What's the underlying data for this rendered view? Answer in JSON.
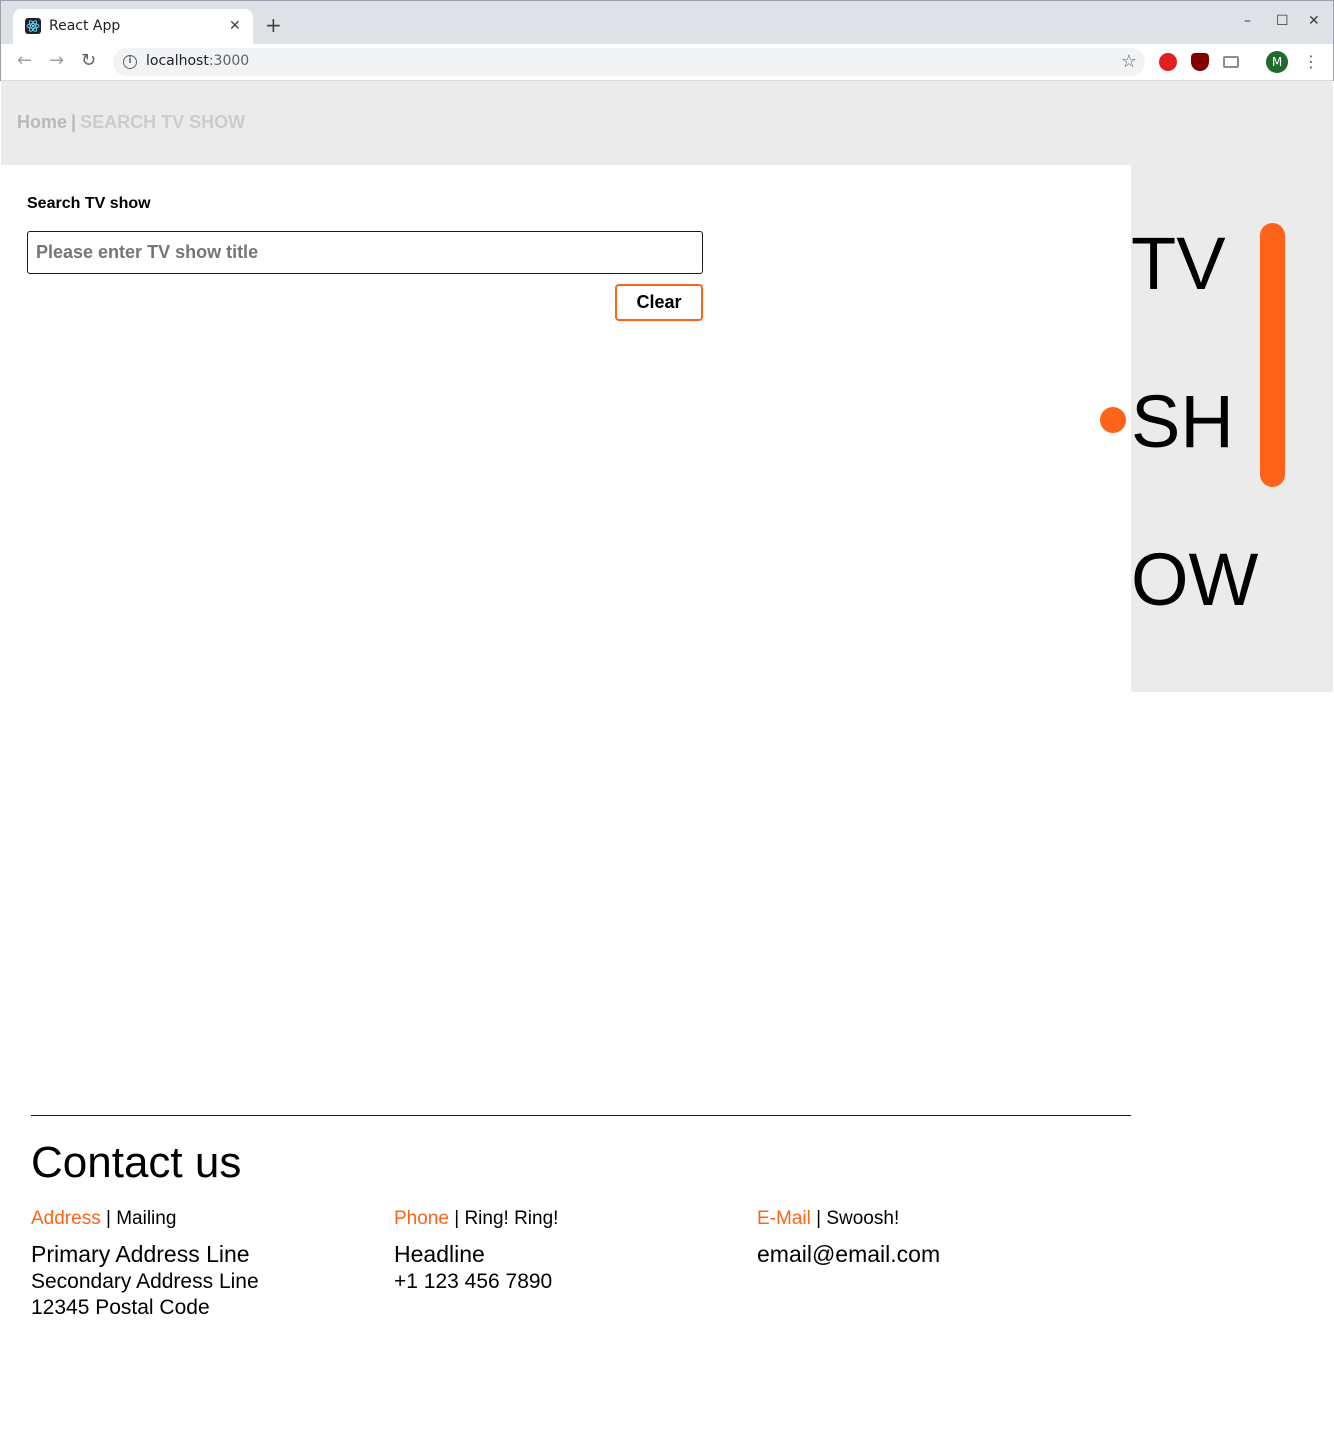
{
  "browser": {
    "tab_title": "React App",
    "tab_close": "✕",
    "new_tab": "+",
    "url_host": "localhost",
    "url_port": ":3000",
    "window_controls": {
      "minimize": "–",
      "maximize": "☐",
      "close": "✕"
    },
    "profile_initial": "M",
    "icons": [
      "react-favicon",
      "back-arrow-icon",
      "forward-arrow-icon",
      "reload-icon",
      "info-icon",
      "star-icon",
      "opera-icon",
      "ublock-icon",
      "cast-icon",
      "menu-icon"
    ]
  },
  "header": {
    "home": "Home",
    "separator": "|",
    "current": "SEARCH TV SHOW"
  },
  "search": {
    "label": "Search TV show",
    "placeholder": "Please enter TV show title",
    "value": "",
    "clear_label": "Clear"
  },
  "side_panel": {
    "lines": [
      "TV",
      "SH",
      "OW"
    ],
    "accent_color": "#ff6319",
    "background": "#ebebeb"
  },
  "footer": {
    "title": "Contact us",
    "columns": [
      {
        "accent": "Address",
        "separator": "|",
        "sub": "Mailing",
        "lines": [
          "Primary Address Line",
          "Secondary Address Line",
          "12345 Postal Code"
        ]
      },
      {
        "accent": "Phone",
        "separator": "|",
        "sub": "Ring! Ring!",
        "lines": [
          "Headline",
          "+1 123 456 7890"
        ]
      },
      {
        "accent": "E-Mail",
        "separator": "|",
        "sub": "Swoosh!",
        "lines": [
          "email@email.com"
        ]
      }
    ]
  },
  "colors": {
    "accent": "#ff6319",
    "header_bg": "#ebebeb",
    "breadcrumb": "#b9b9b9"
  }
}
